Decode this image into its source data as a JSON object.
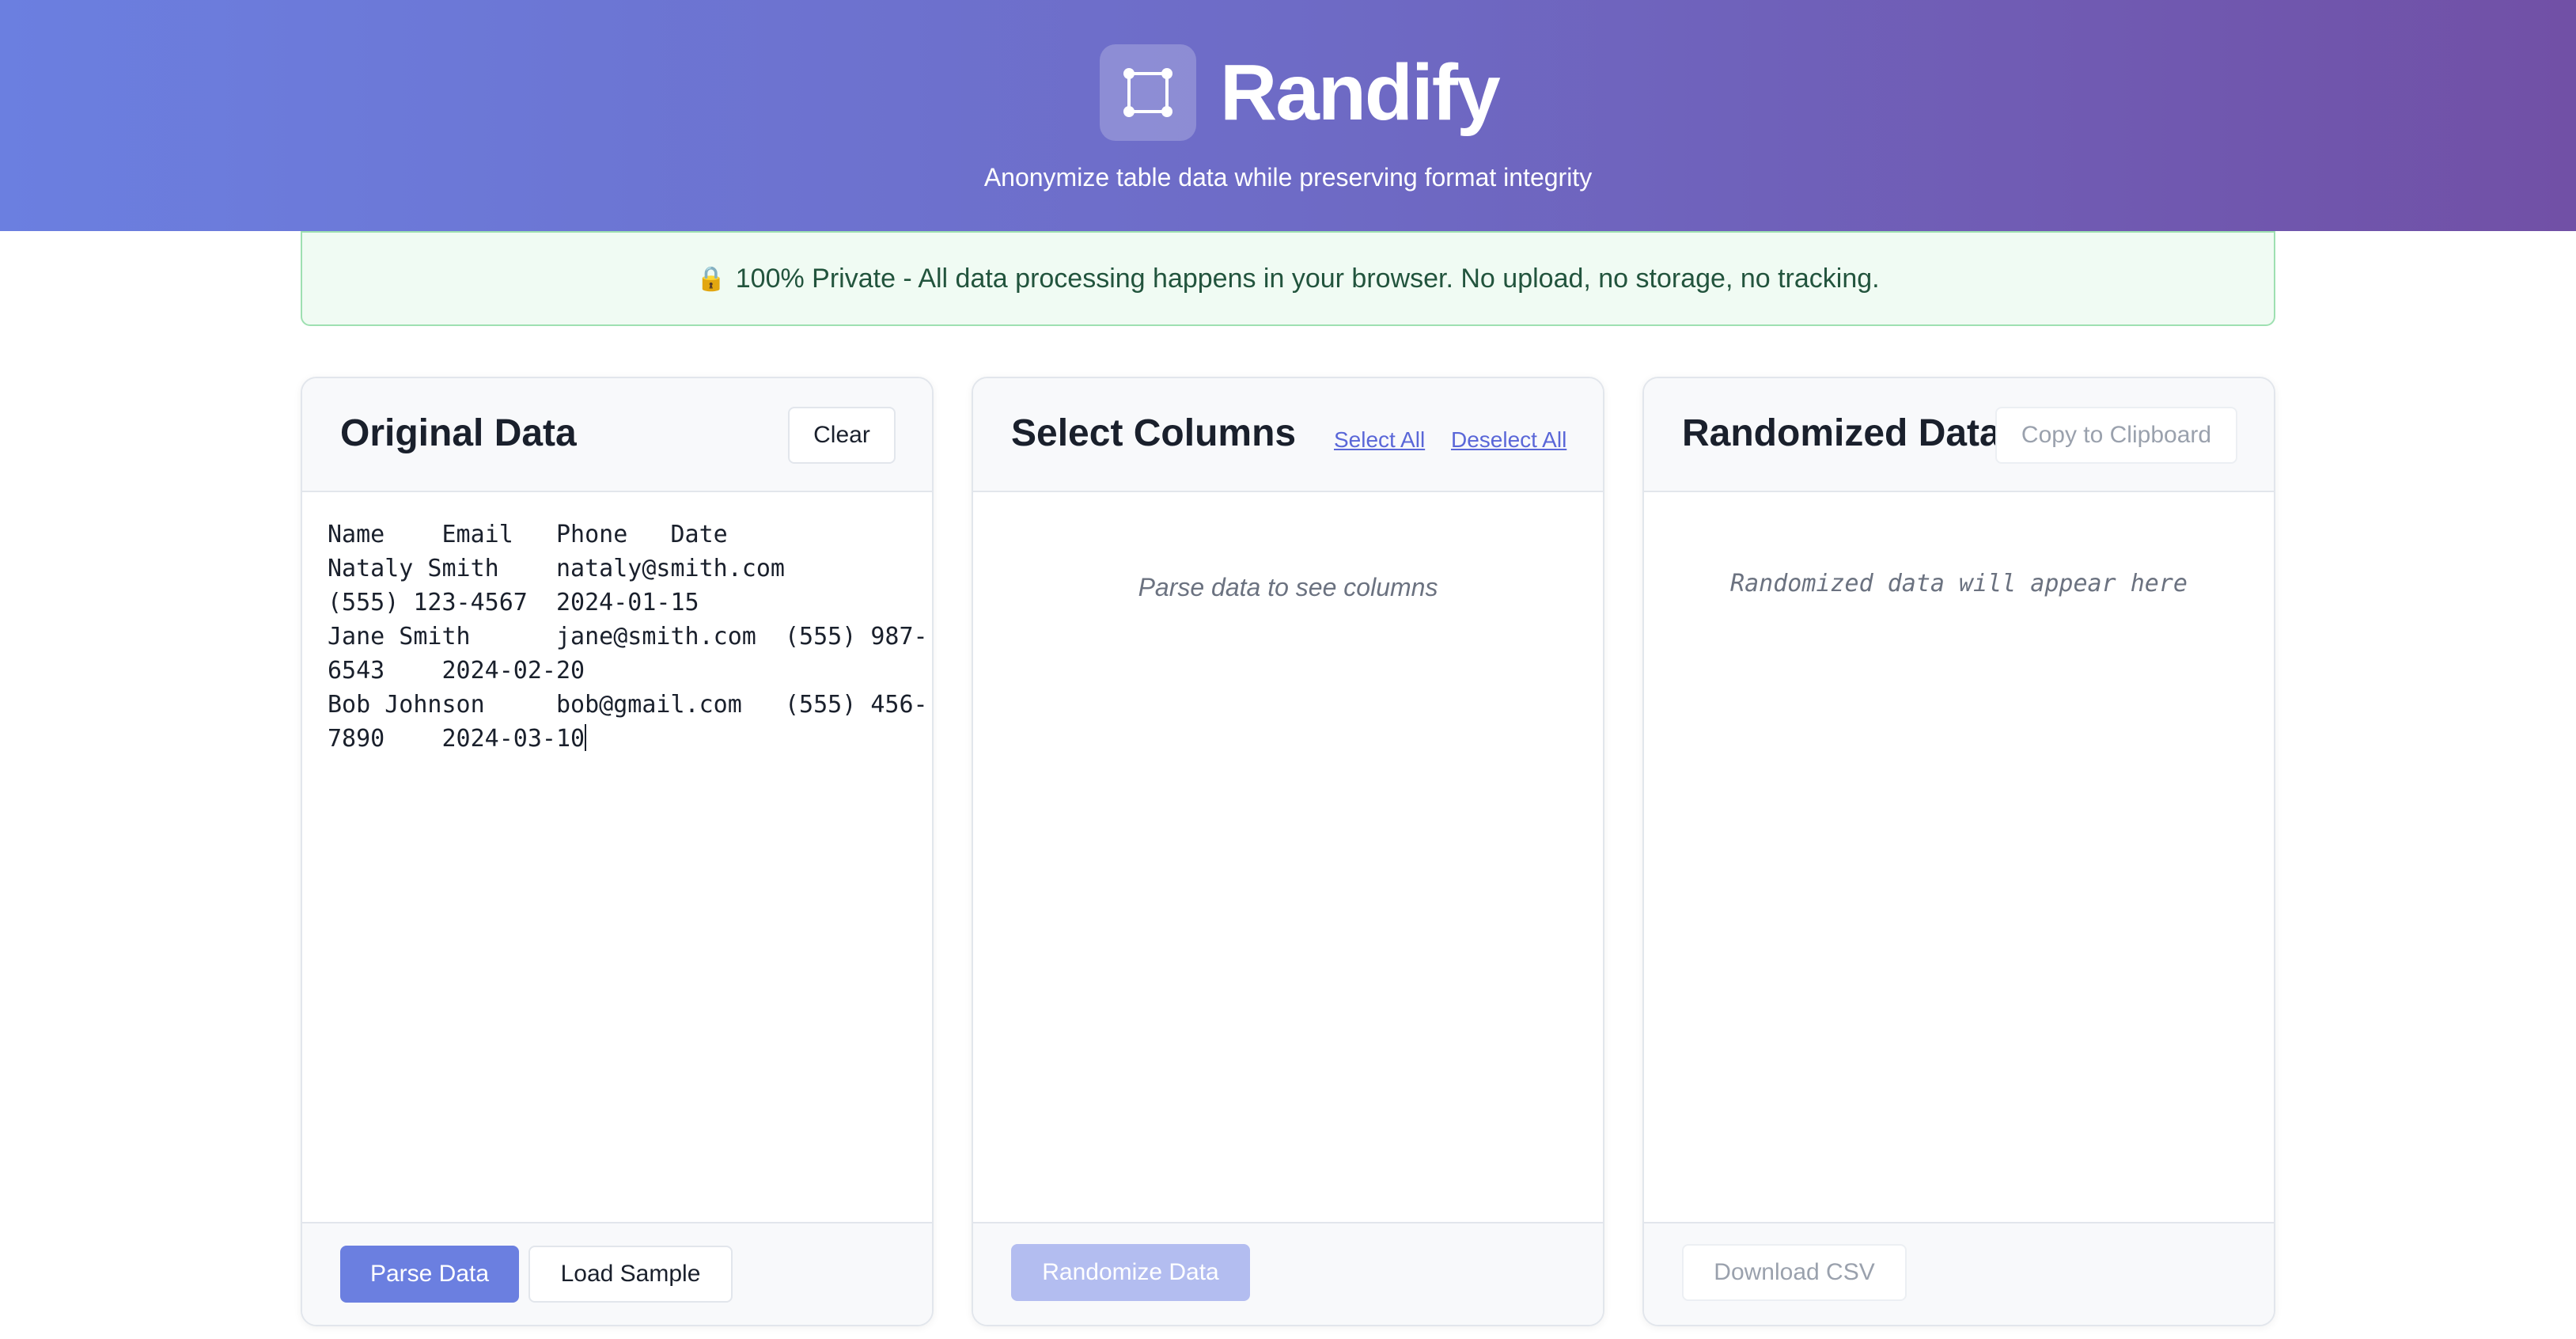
{
  "header": {
    "app_name": "Randify",
    "logo_icon": "crop-frame-icon",
    "tagline": "Anonymize table data while preserving format integrity",
    "gradient": [
      "#6b7fe0",
      "#7150a6"
    ]
  },
  "privacy_notice": {
    "icon": "lock-icon",
    "text": "100% Private - All data processing happens in your browser. No upload, no storage, no tracking."
  },
  "panels": {
    "original": {
      "title": "Original Data",
      "clear_label": "Clear",
      "input_lines": [
        "Name    Email   Phone   Date",
        "Nataly Smith    nataly@smith.com",
        "(555) 123-4567  2024-01-15",
        "Jane Smith      jane@smith.com  (555) 987-",
        "6543    2024-02-20",
        "Bob Johnson     bob@gmail.com   (555) 456-",
        "7890    2024-03-10"
      ],
      "parse_label": "Parse Data",
      "sample_label": "Load Sample"
    },
    "columns": {
      "title": "Select Columns",
      "select_all_label": "Select All",
      "deselect_all_label": "Deselect All",
      "empty_text": "Parse data to see columns",
      "randomize_label": "Randomize Data"
    },
    "randomized": {
      "title": "Randomized Data",
      "copy_label": "Copy to Clipboard",
      "empty_text": "Randomized data will appear here",
      "download_label": "Download CSV"
    }
  },
  "colors": {
    "primary": "#6b7fe0",
    "primary_disabled": "#b3bdf0",
    "privacy_bg": "#f0fbf3",
    "privacy_border": "#9ee0b1",
    "link": "#5a67d8"
  }
}
